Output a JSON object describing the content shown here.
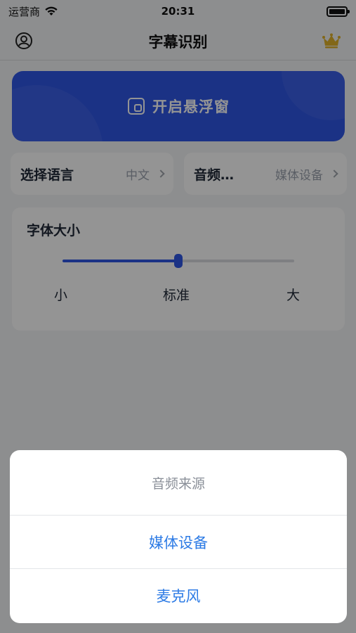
{
  "status_bar": {
    "carrier": "运营商",
    "time": "20:31",
    "wifi_icon": "wifi-icon",
    "battery_icon": "battery-icon"
  },
  "nav": {
    "title": "字幕识别",
    "left_icon": "user-icon",
    "right_icon": "crown-icon"
  },
  "float_window": {
    "label": "开启悬浮窗",
    "icon": "floating-window-icon"
  },
  "options": {
    "language": {
      "label": "选择语言",
      "value": "中文"
    },
    "audio": {
      "label": "音频…",
      "value": "媒体设备"
    }
  },
  "font_size": {
    "title": "字体大小",
    "levels": [
      "小",
      "标准",
      "大"
    ],
    "selected_fraction": 0.5
  },
  "action_sheet": {
    "title": "音频来源",
    "options": [
      "媒体设备",
      "麦克风"
    ]
  },
  "colors": {
    "accent": "#2f57e6",
    "sheet_option": "#2d7be5",
    "crown": "#e0b12a"
  }
}
